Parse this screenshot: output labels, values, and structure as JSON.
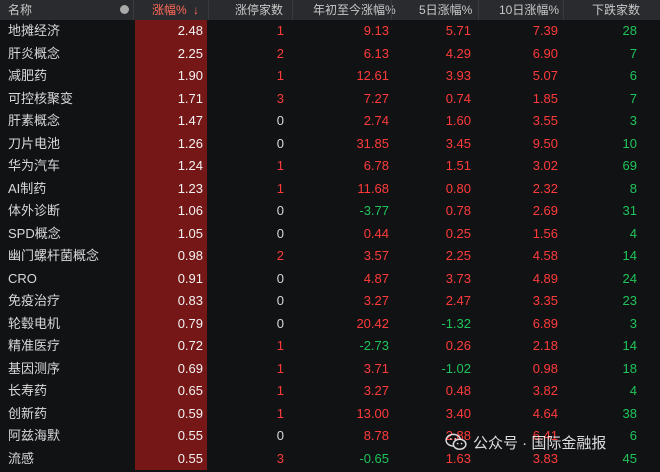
{
  "header": {
    "name": "名称",
    "pct": "涨幅%",
    "sort_arrow": "↓",
    "limit_up": "涨停家数",
    "ytd": "年初至今涨幅%",
    "d5": "5日涨幅%",
    "d10": "10日涨幅%",
    "down": "下跌家数"
  },
  "rows": [
    {
      "name": "地摊经济",
      "pct": "2.48",
      "limit_up": "1",
      "ytd": "9.13",
      "d5": "5.71",
      "d10": "7.39",
      "down": "28"
    },
    {
      "name": "肝炎概念",
      "pct": "2.25",
      "limit_up": "2",
      "ytd": "6.13",
      "d5": "4.29",
      "d10": "6.90",
      "down": "7"
    },
    {
      "name": "减肥药",
      "pct": "1.90",
      "limit_up": "1",
      "ytd": "12.61",
      "d5": "3.93",
      "d10": "5.07",
      "down": "6"
    },
    {
      "name": "可控核聚变",
      "pct": "1.71",
      "limit_up": "3",
      "ytd": "7.27",
      "d5": "0.74",
      "d10": "1.85",
      "down": "7"
    },
    {
      "name": "肝素概念",
      "pct": "1.47",
      "limit_up": "0",
      "ytd": "2.74",
      "d5": "1.60",
      "d10": "3.55",
      "down": "3"
    },
    {
      "name": "刀片电池",
      "pct": "1.26",
      "limit_up": "0",
      "ytd": "31.85",
      "d5": "3.45",
      "d10": "9.50",
      "down": "10"
    },
    {
      "name": "华为汽车",
      "pct": "1.24",
      "limit_up": "1",
      "ytd": "6.78",
      "d5": "1.51",
      "d10": "3.02",
      "down": "69"
    },
    {
      "name": "AI制药",
      "pct": "1.23",
      "limit_up": "1",
      "ytd": "11.68",
      "d5": "0.80",
      "d10": "2.32",
      "down": "8"
    },
    {
      "name": "体外诊断",
      "pct": "1.06",
      "limit_up": "0",
      "ytd": "-3.77",
      "d5": "0.78",
      "d10": "2.69",
      "down": "31"
    },
    {
      "name": "SPD概念",
      "pct": "1.05",
      "limit_up": "0",
      "ytd": "0.44",
      "d5": "0.25",
      "d10": "1.56",
      "down": "4"
    },
    {
      "name": "幽门螺杆菌概念",
      "pct": "0.98",
      "limit_up": "2",
      "ytd": "3.57",
      "d5": "2.25",
      "d10": "4.58",
      "down": "14"
    },
    {
      "name": "CRO",
      "pct": "0.91",
      "limit_up": "0",
      "ytd": "4.87",
      "d5": "3.73",
      "d10": "4.89",
      "down": "24"
    },
    {
      "name": "免疫治疗",
      "pct": "0.83",
      "limit_up": "0",
      "ytd": "3.27",
      "d5": "2.47",
      "d10": "3.35",
      "down": "23"
    },
    {
      "name": "轮毂电机",
      "pct": "0.79",
      "limit_up": "0",
      "ytd": "20.42",
      "d5": "-1.32",
      "d10": "6.89",
      "down": "3"
    },
    {
      "name": "精准医疗",
      "pct": "0.72",
      "limit_up": "1",
      "ytd": "-2.73",
      "d5": "0.26",
      "d10": "2.18",
      "down": "14"
    },
    {
      "name": "基因测序",
      "pct": "0.69",
      "limit_up": "1",
      "ytd": "3.71",
      "d5": "-1.02",
      "d10": "0.98",
      "down": "18"
    },
    {
      "name": "长寿药",
      "pct": "0.65",
      "limit_up": "1",
      "ytd": "3.27",
      "d5": "0.48",
      "d10": "3.82",
      "down": "4"
    },
    {
      "name": "创新药",
      "pct": "0.59",
      "limit_up": "1",
      "ytd": "13.00",
      "d5": "3.40",
      "d10": "4.64",
      "down": "38"
    },
    {
      "name": "阿兹海默",
      "pct": "0.55",
      "limit_up": "0",
      "ytd": "8.78",
      "d5": "2.88",
      "d10": "6.41",
      "down": "6"
    },
    {
      "name": "流感",
      "pct": "0.55",
      "limit_up": "3",
      "ytd": "-0.65",
      "d5": "1.63",
      "d10": "3.83",
      "down": "45"
    }
  ],
  "watermark": {
    "icon": "wechat-icon",
    "text": "公众号 · 国际金融报"
  },
  "colors": {
    "up": "#ff3b3b",
    "down": "#1fc45a",
    "zero": "#d8d8d8",
    "highlight_column": "#761717",
    "header_bg": "#2a2b2e",
    "background": "#111214"
  }
}
